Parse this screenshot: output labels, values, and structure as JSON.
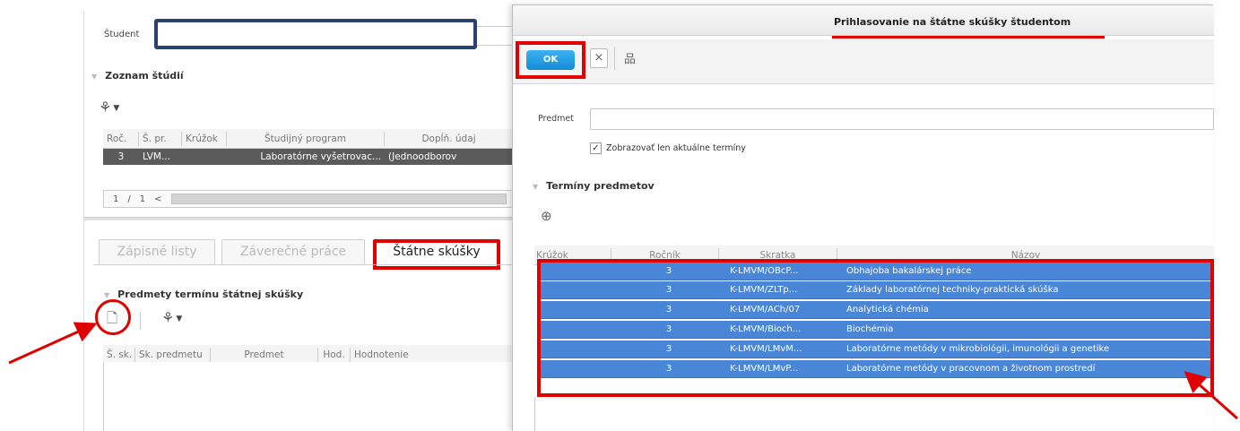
{
  "student": {
    "label": "Študent",
    "value": ""
  },
  "studies": {
    "header": "Zoznam štúdií",
    "columns": [
      "Roč.",
      "Š. pr.",
      "Krúžok",
      "Študijný program",
      "Dopĺň. údaj"
    ],
    "row": [
      "3",
      "LVM...",
      "",
      "Laboratórne vyšetrovac...",
      "(Jednoodborov"
    ],
    "pager": {
      "page": "1",
      "sep": "/",
      "total": "1",
      "prev": "<"
    }
  },
  "tabs": [
    {
      "label": "Zápisné listy"
    },
    {
      "label": "Záverečné práce"
    },
    {
      "label": "Štátne skúšky"
    }
  ],
  "subjects": {
    "header": "Predmety termínu štátnej skúšky",
    "columns": [
      "Š. sk.",
      "Sk. predmetu",
      "Predmet",
      "Hod.",
      "Hodnotenie"
    ]
  },
  "modal": {
    "title": "Prihlasovanie na štátne skúšky študentom",
    "ok_label": "OK",
    "close_label": "×",
    "predmet_label": "Predmet",
    "predmet_value": "",
    "checkbox_label": "Zobrazovať len aktuálne termíny",
    "checkbox_checked": true,
    "terms_header": "Termíny predmetov",
    "columns": [
      "Krúžok",
      "Ročník",
      "Skratka",
      "Názov"
    ],
    "rows": [
      {
        "krouzok": "",
        "rocnik": "3",
        "skratka": "K-LMVM/OBcP...",
        "nazov": "Obhajoba bakalárskej práce"
      },
      {
        "krouzok": "",
        "rocnik": "3",
        "skratka": "K-LMVM/ZLTp...",
        "nazov": "Základy laboratórnej techniky-praktická skúška"
      },
      {
        "krouzok": "",
        "rocnik": "3",
        "skratka": "K-LMVM/ACh/07",
        "nazov": "Analytická chémia"
      },
      {
        "krouzok": "",
        "rocnik": "3",
        "skratka": "K-LMVM/Bioch...",
        "nazov": "Biochémia"
      },
      {
        "krouzok": "",
        "rocnik": "3",
        "skratka": "K-LMVM/LMvM...",
        "nazov": "Laboratórne metódy v mikrobiológii, imunológii a genetike"
      },
      {
        "krouzok": "",
        "rocnik": "3",
        "skratka": "K-LMVM/LMvP...",
        "nazov": "Laboratórne metódy v pracovnom a životnom prostredí"
      }
    ]
  },
  "colors": {
    "accent_red": "#e00000",
    "selection_blue": "#4a86d8",
    "ok_blue": "#1a8fdb",
    "student_border": "#2b4270"
  },
  "icons": [
    "run-icon",
    "add-document-icon",
    "zoom-in-icon",
    "sitemap-icon",
    "close-icon",
    "checkbox-check-icon"
  ]
}
